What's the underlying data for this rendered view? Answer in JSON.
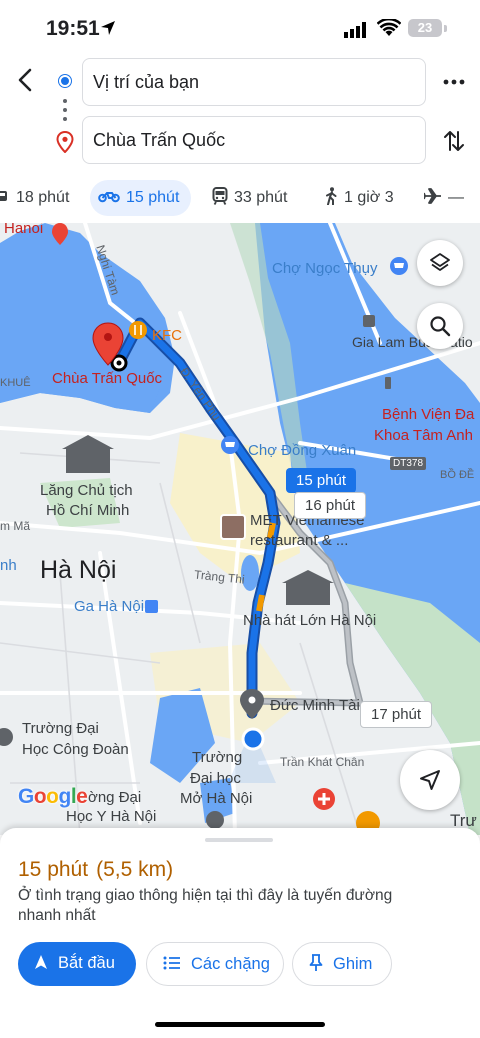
{
  "status_bar": {
    "time": "19:51",
    "battery": "23"
  },
  "search": {
    "origin": "Vị trí của bạn",
    "destination": "Chùa Trấn Quốc"
  },
  "modes": [
    {
      "label": "18 phút",
      "icon": "car-icon"
    },
    {
      "label": "15 phút",
      "icon": "motorbike-icon",
      "active": true
    },
    {
      "label": "33 phút",
      "icon": "transit-icon"
    },
    {
      "label": "1 giờ 3",
      "icon": "walk-icon"
    },
    {
      "label": "—",
      "icon": "flight-icon"
    }
  ],
  "map": {
    "labels": {
      "hanoi_en": "Hanoi",
      "nghi_tam": "Nghi Tàm",
      "kfc": "KFC",
      "cho_ngoc_thuy": "Chợ Ngọc Thụy",
      "gia_lam": "Gia Lam Bus Statio",
      "yen_phu": "Đ. Yên Phụ",
      "chua_tran_quoc": "Chùa Trấn Quốc",
      "khue": "KHUÊ",
      "benh_vien_1": "Bệnh Viện Đa",
      "benh_vien_2": "Khoa Tâm Anh",
      "cho_dong_xuan": "Chợ Đồng Xuân",
      "dt378": "DT378",
      "bo_de": "BỒ ĐỀ",
      "lang_1": "Lăng Chủ tịch",
      "lang_2": "Hồ Chí Minh",
      "met_1": "MET Vietnamese",
      "met_2": "restaurant & ...",
      "ma": "m Mã",
      "nh": "nh",
      "ha_noi": "Hà Nội",
      "trang_thi": "Tràng Thi",
      "ga_ha_noi": "Ga Hà Nội",
      "nha_hat": "Nhà hát Lớn Hà Nội",
      "duc_minh_tai": "Đức Minh Tài",
      "truong_cong_doan_1": "Trường Đại",
      "truong_cong_doan_2": "Học Công Đoàn",
      "truong_mo_1": "Trường",
      "truong_mo_2": "Đại học",
      "truong_mo_3": "Mở Hà Nội",
      "tran_khat_chan": "Trần Khát Chân",
      "y_hn_1": "ờng Đại",
      "y_hn_2": "Học Y Hà Nội",
      "tru": "Trư"
    },
    "eta_main": "15 phút",
    "eta_alt_1": "16 phút",
    "eta_alt_2": "17 phút",
    "logo": [
      "G",
      "o",
      "o",
      "g",
      "l",
      "e"
    ],
    "route_color": "#1a73e8",
    "alt_route_color": "#9aa0a6"
  },
  "sheet": {
    "duration": "15 phút",
    "distance": "(5,5 km)",
    "description": "Ở tình trạng giao thông hiện tại thì đây là tuyến đường nhanh nhất",
    "start_label": "Bắt đầu",
    "steps_label": "Các chặng",
    "pin_label": "Ghim"
  }
}
